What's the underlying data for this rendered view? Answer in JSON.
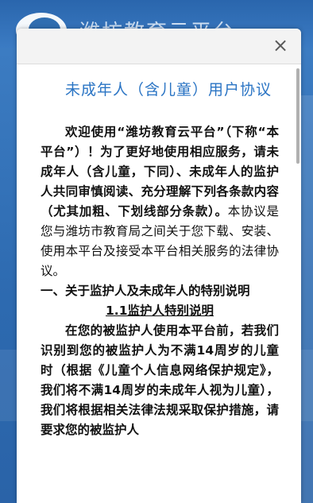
{
  "background": {
    "title": "潍坊教育云平台"
  },
  "modal": {
    "close_glyph": "×",
    "title": "未成年人（含儿童）用户协议",
    "intro_bold": "欢迎使用“潍坊教育云平台”（下称“本平台”）！为了更好地使用相应服务，请未成年人（含儿童，下同）、未成年人的监护人共同审慎阅读、充分理解下列各条款内容（尤其加粗、下划线部分条款）。",
    "intro_regular": "本协议是您与潍坊市教育局之间关于您下载、安装、使用本平台及接受本平台相关服务的法律协议。",
    "section1": "一、关于监护人及未成年人的特别说明",
    "subsection": "1.1监护人特别说明",
    "para_bold": "在您的被监护人使用本平台前，若我们识别到您的被监护人为不满14周岁的儿童时（根据《儿童个人信息网络保护规定》，我们将不满14周岁的未成年人视为儿童），我们将根据相关法律法规采取保护措施，请要求您的被监护人"
  },
  "colors": {
    "accent": "#2a74c4",
    "background": "#2f6db0"
  }
}
